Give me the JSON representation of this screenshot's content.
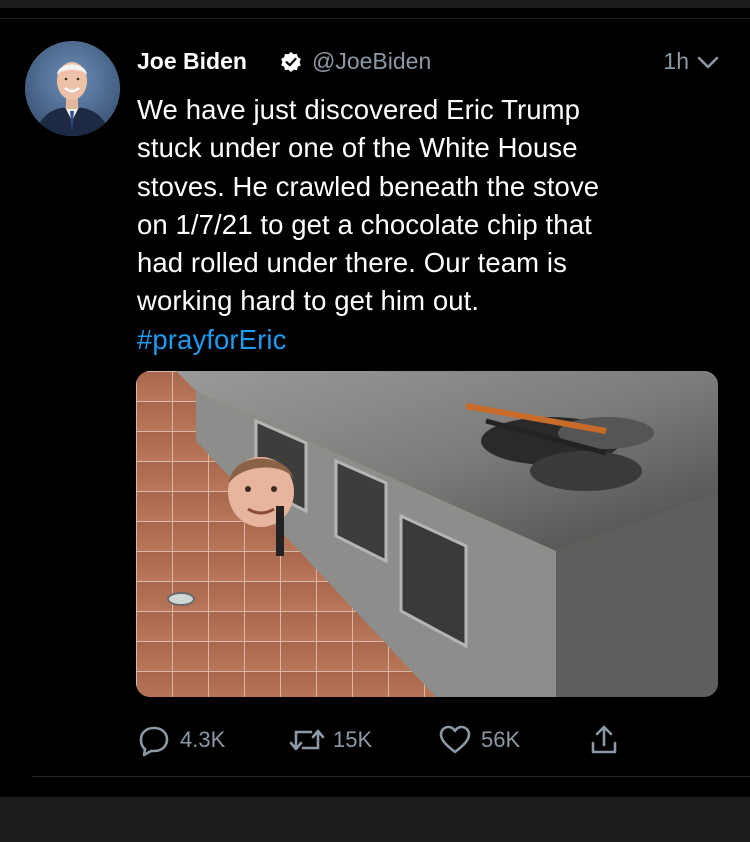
{
  "tweet": {
    "display_name": "Joe Biden",
    "handle": "@JoeBiden",
    "timestamp": "1h",
    "text_lines": [
      "We have just discovered Eric Trump",
      "stuck under one of the White House",
      "stoves. He crawled beneath the stove",
      "on 1/7/21 to get a chocolate chip that",
      "had rolled under there. Our team is",
      "working hard to get him out."
    ],
    "hashtag": "#prayforEric",
    "verified": true
  },
  "actions": {
    "reply_count": "4.3K",
    "retweet_count": "15K",
    "like_count": "56K"
  },
  "colors": {
    "background": "#000000",
    "text": "#ffffff",
    "secondary": "#8b98a5",
    "hashtag": "#1d9bf0"
  },
  "icons": {
    "verified": "verified-badge-icon",
    "menu": "chevron-down-icon",
    "reply": "reply-icon",
    "retweet": "retweet-icon",
    "like": "heart-icon",
    "share": "share-icon"
  }
}
